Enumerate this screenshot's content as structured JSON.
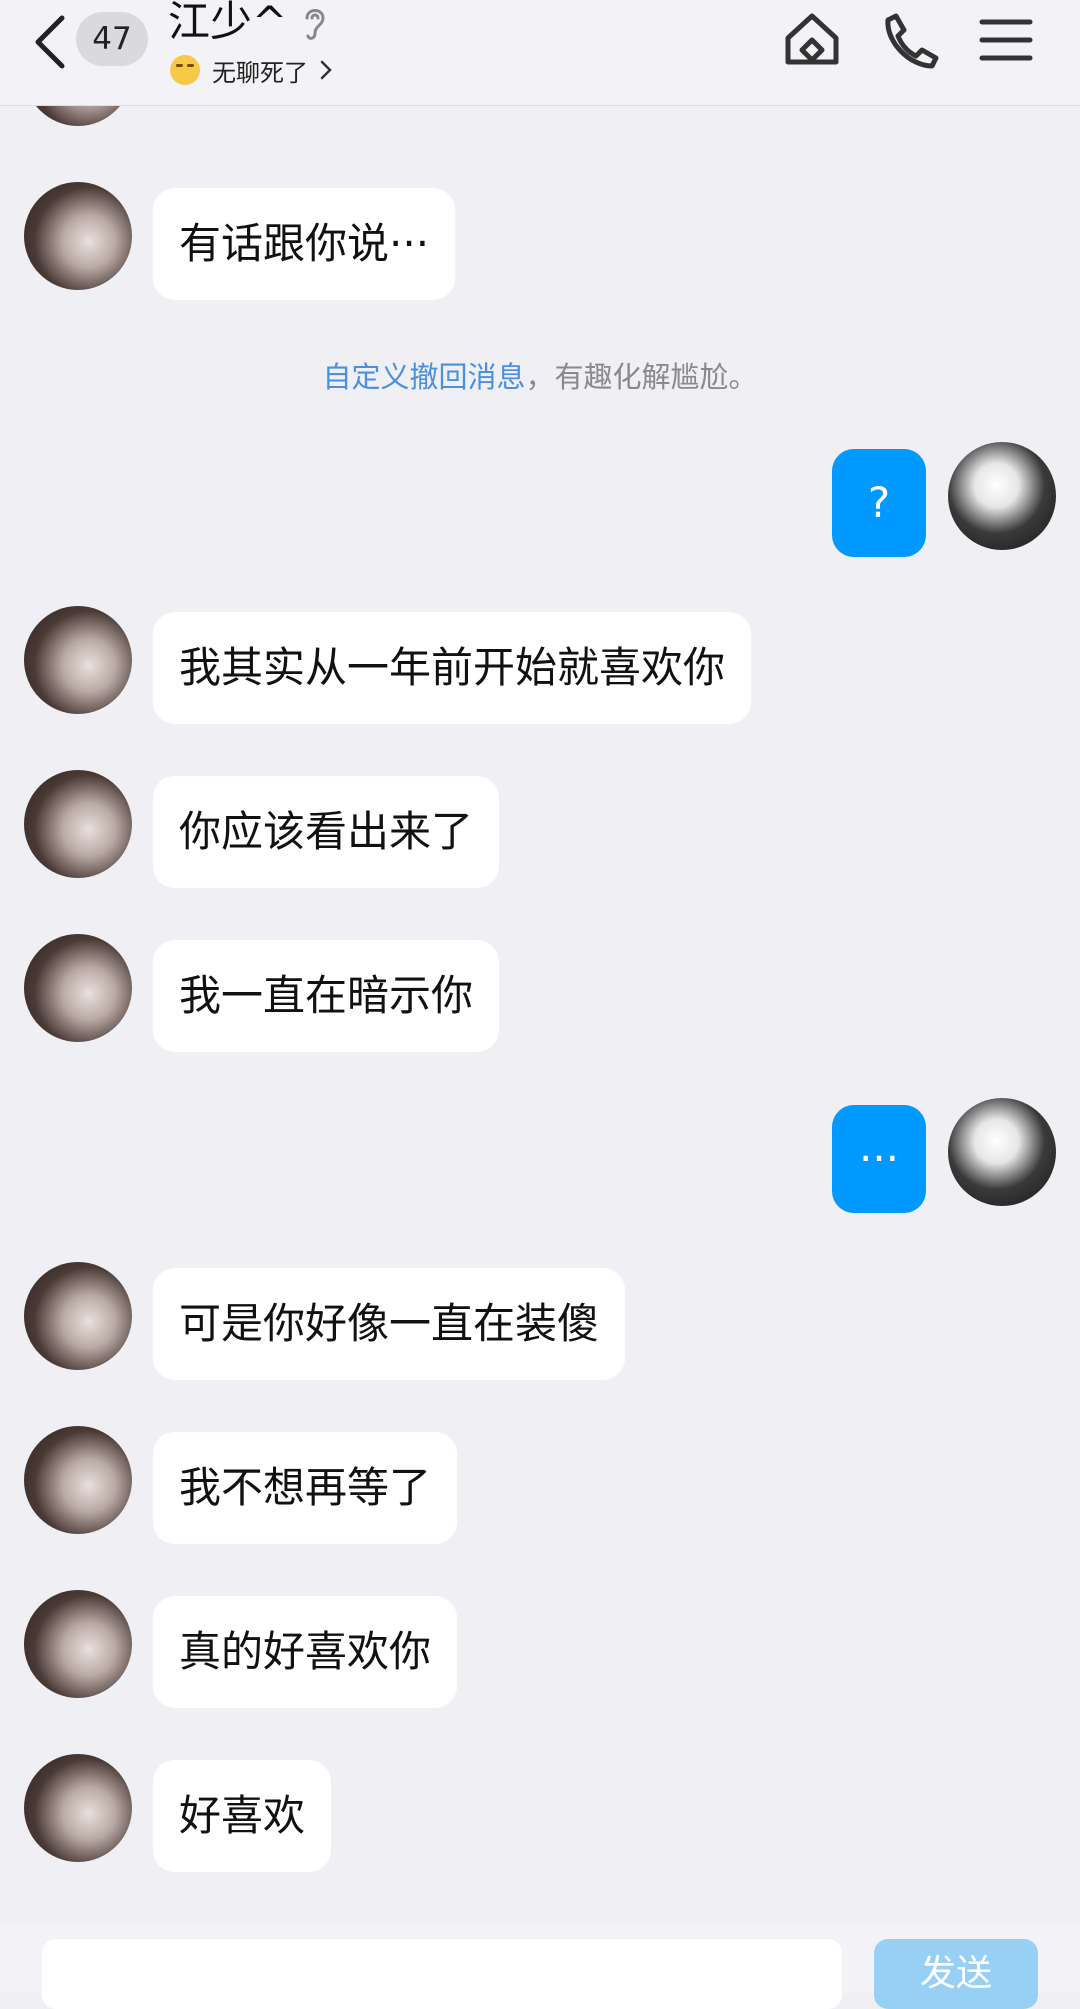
{
  "header": {
    "unread_count": "47",
    "title": "江少^",
    "status_text": "无聊死了"
  },
  "system_note": {
    "link_text": "自定义撤回消息",
    "rest_text": "，有趣化解尴尬。"
  },
  "messages": [
    {
      "from": "other",
      "text": "有话跟你说···"
    },
    {
      "from": "me",
      "text": "?"
    },
    {
      "from": "other",
      "text": "我其实从一年前开始就喜欢你"
    },
    {
      "from": "other",
      "text": "你应该看出来了"
    },
    {
      "from": "other",
      "text": "我一直在暗示你"
    },
    {
      "from": "me",
      "text": "···"
    },
    {
      "from": "other",
      "text": "可是你好像一直在装傻"
    },
    {
      "from": "other",
      "text": "我不想再等了"
    },
    {
      "from": "other",
      "text": "真的好喜欢你"
    },
    {
      "from": "other",
      "text": "好喜欢"
    }
  ],
  "composer": {
    "send_label": "发送"
  },
  "colors": {
    "accent": "#0099ff",
    "link": "#4a90e2",
    "background": "#efeff4"
  }
}
